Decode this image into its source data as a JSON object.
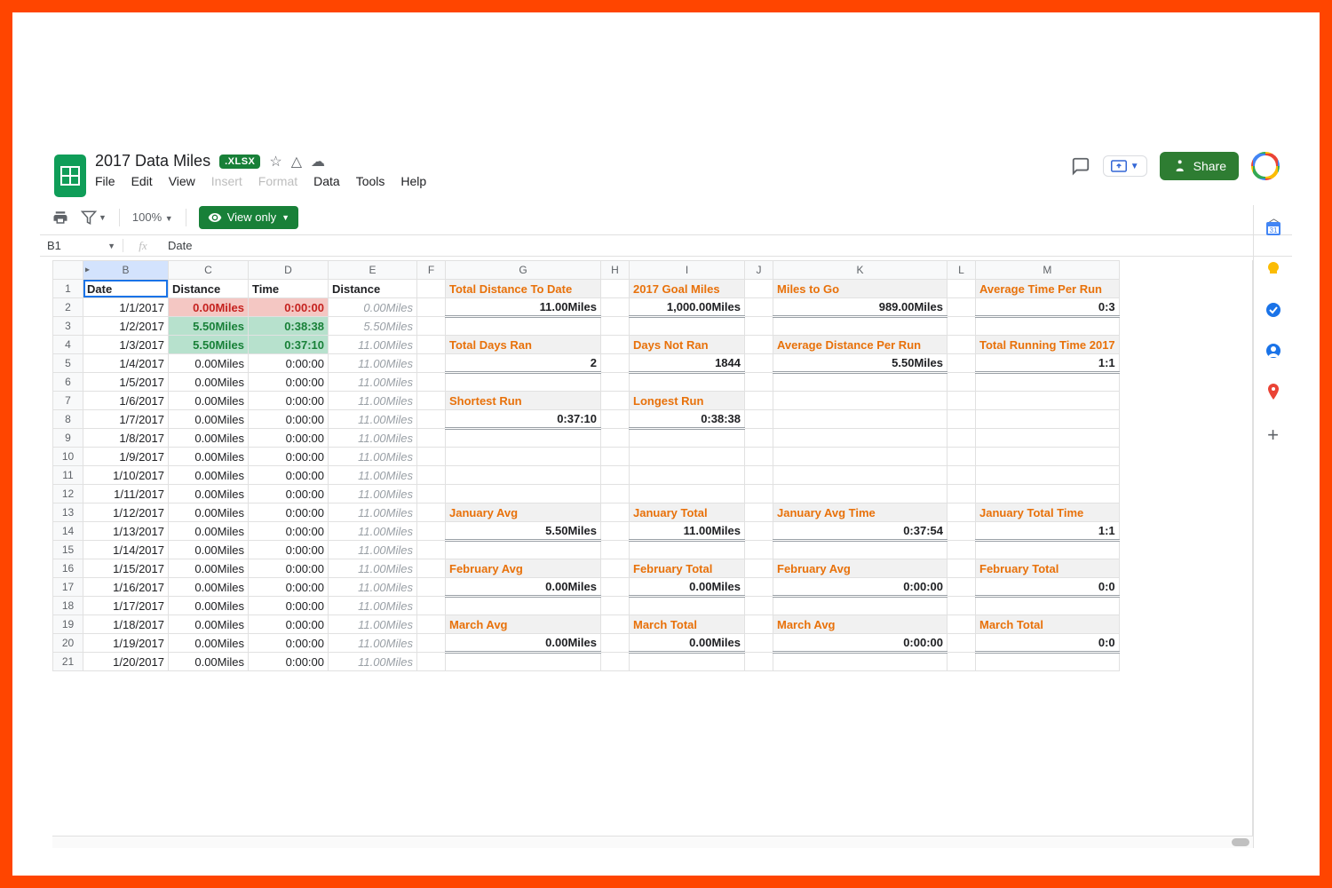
{
  "doc": {
    "title": "2017 Data Miles",
    "badge": ".XLSX",
    "menus": [
      "File",
      "Edit",
      "View",
      "Insert",
      "Format",
      "Data",
      "Tools",
      "Help"
    ],
    "menus_disabled": [
      "Insert",
      "Format"
    ],
    "share_label": "Share"
  },
  "toolbar": {
    "zoom": "100%",
    "view_only": "View only"
  },
  "fx": {
    "namebox": "B1",
    "value": "Date"
  },
  "columns": [
    "B",
    "C",
    "D",
    "E",
    "F",
    "G",
    "H",
    "I",
    "J",
    "K",
    "L",
    "M"
  ],
  "headers": {
    "B": "Date",
    "C": "Distance",
    "D": "Time",
    "E": "Distance"
  },
  "rows": [
    {
      "n": 1
    },
    {
      "n": 2,
      "B": "1/1/2017",
      "C": "0.00Miles",
      "D": "0:00:00",
      "E": "0.00Miles",
      "fill": "red"
    },
    {
      "n": 3,
      "B": "1/2/2017",
      "C": "5.50Miles",
      "D": "0:38:38",
      "E": "5.50Miles",
      "fill": "green"
    },
    {
      "n": 4,
      "B": "1/3/2017",
      "C": "5.50Miles",
      "D": "0:37:10",
      "E": "11.00Miles",
      "fill": "green"
    },
    {
      "n": 5,
      "B": "1/4/2017",
      "C": "0.00Miles",
      "D": "0:00:00",
      "E": "11.00Miles"
    },
    {
      "n": 6,
      "B": "1/5/2017",
      "C": "0.00Miles",
      "D": "0:00:00",
      "E": "11.00Miles"
    },
    {
      "n": 7,
      "B": "1/6/2017",
      "C": "0.00Miles",
      "D": "0:00:00",
      "E": "11.00Miles"
    },
    {
      "n": 8,
      "B": "1/7/2017",
      "C": "0.00Miles",
      "D": "0:00:00",
      "E": "11.00Miles"
    },
    {
      "n": 9,
      "B": "1/8/2017",
      "C": "0.00Miles",
      "D": "0:00:00",
      "E": "11.00Miles"
    },
    {
      "n": 10,
      "B": "1/9/2017",
      "C": "0.00Miles",
      "D": "0:00:00",
      "E": "11.00Miles"
    },
    {
      "n": 11,
      "B": "1/10/2017",
      "C": "0.00Miles",
      "D": "0:00:00",
      "E": "11.00Miles"
    },
    {
      "n": 12,
      "B": "1/11/2017",
      "C": "0.00Miles",
      "D": "0:00:00",
      "E": "11.00Miles"
    },
    {
      "n": 13,
      "B": "1/12/2017",
      "C": "0.00Miles",
      "D": "0:00:00",
      "E": "11.00Miles"
    },
    {
      "n": 14,
      "B": "1/13/2017",
      "C": "0.00Miles",
      "D": "0:00:00",
      "E": "11.00Miles"
    },
    {
      "n": 15,
      "B": "1/14/2017",
      "C": "0.00Miles",
      "D": "0:00:00",
      "E": "11.00Miles"
    },
    {
      "n": 16,
      "B": "1/15/2017",
      "C": "0.00Miles",
      "D": "0:00:00",
      "E": "11.00Miles"
    },
    {
      "n": 17,
      "B": "1/16/2017",
      "C": "0.00Miles",
      "D": "0:00:00",
      "E": "11.00Miles"
    },
    {
      "n": 18,
      "B": "1/17/2017",
      "C": "0.00Miles",
      "D": "0:00:00",
      "E": "11.00Miles"
    },
    {
      "n": 19,
      "B": "1/18/2017",
      "C": "0.00Miles",
      "D": "0:00:00",
      "E": "11.00Miles"
    },
    {
      "n": 20,
      "B": "1/19/2017",
      "C": "0.00Miles",
      "D": "0:00:00",
      "E": "11.00Miles"
    },
    {
      "n": 21,
      "B": "1/20/2017",
      "C": "0.00Miles",
      "D": "0:00:00",
      "E": "11.00Miles"
    }
  ],
  "stats": [
    {
      "row": 1,
      "G": "Total Distance To Date",
      "I": "2017 Goal Miles",
      "K": "Miles to Go",
      "M": "Average Time Per Run",
      "type": "label"
    },
    {
      "row": 2,
      "G": "11.00Miles",
      "I": "1,000.00Miles",
      "K": "989.00Miles",
      "M": "0:3",
      "type": "value"
    },
    {
      "row": 4,
      "G": "Total Days Ran",
      "I": "Days Not Ran",
      "K": "Average Distance Per Run",
      "M": "Total Running Time 2017",
      "type": "label"
    },
    {
      "row": 5,
      "G": "2",
      "I": "1844",
      "K": "5.50Miles",
      "M": "1:1",
      "type": "value"
    },
    {
      "row": 7,
      "G": "Shortest Run",
      "I": "Longest Run",
      "type": "label"
    },
    {
      "row": 8,
      "G": "0:37:10",
      "I": "0:38:38",
      "type": "value"
    },
    {
      "row": 13,
      "G": "January Avg",
      "I": "January Total",
      "K": "January Avg Time",
      "M": "January Total Time",
      "type": "label"
    },
    {
      "row": 14,
      "G": "5.50Miles",
      "I": "11.00Miles",
      "K": "0:37:54",
      "M": "1:1",
      "type": "value"
    },
    {
      "row": 16,
      "G": "February Avg",
      "I": "February Total",
      "K": "February Avg",
      "M": "February Total",
      "type": "label"
    },
    {
      "row": 17,
      "G": "0.00Miles",
      "I": "0.00Miles",
      "K": "0:00:00",
      "M": "0:0",
      "type": "value"
    },
    {
      "row": 19,
      "G": "March Avg",
      "I": "March Total",
      "K": "March Avg",
      "M": "March Total",
      "type": "label"
    },
    {
      "row": 20,
      "G": "0.00Miles",
      "I": "0.00Miles",
      "K": "0:00:00",
      "M": "0:0",
      "type": "value"
    }
  ],
  "sidepanel": {
    "icons": [
      {
        "name": "calendar-icon",
        "color": "#4285f4"
      },
      {
        "name": "keep-icon",
        "color": "#fbbc04"
      },
      {
        "name": "tasks-icon",
        "color": "#1a73e8"
      },
      {
        "name": "contacts-icon",
        "color": "#1a73e8"
      },
      {
        "name": "maps-icon",
        "color": "#34a853"
      }
    ]
  }
}
